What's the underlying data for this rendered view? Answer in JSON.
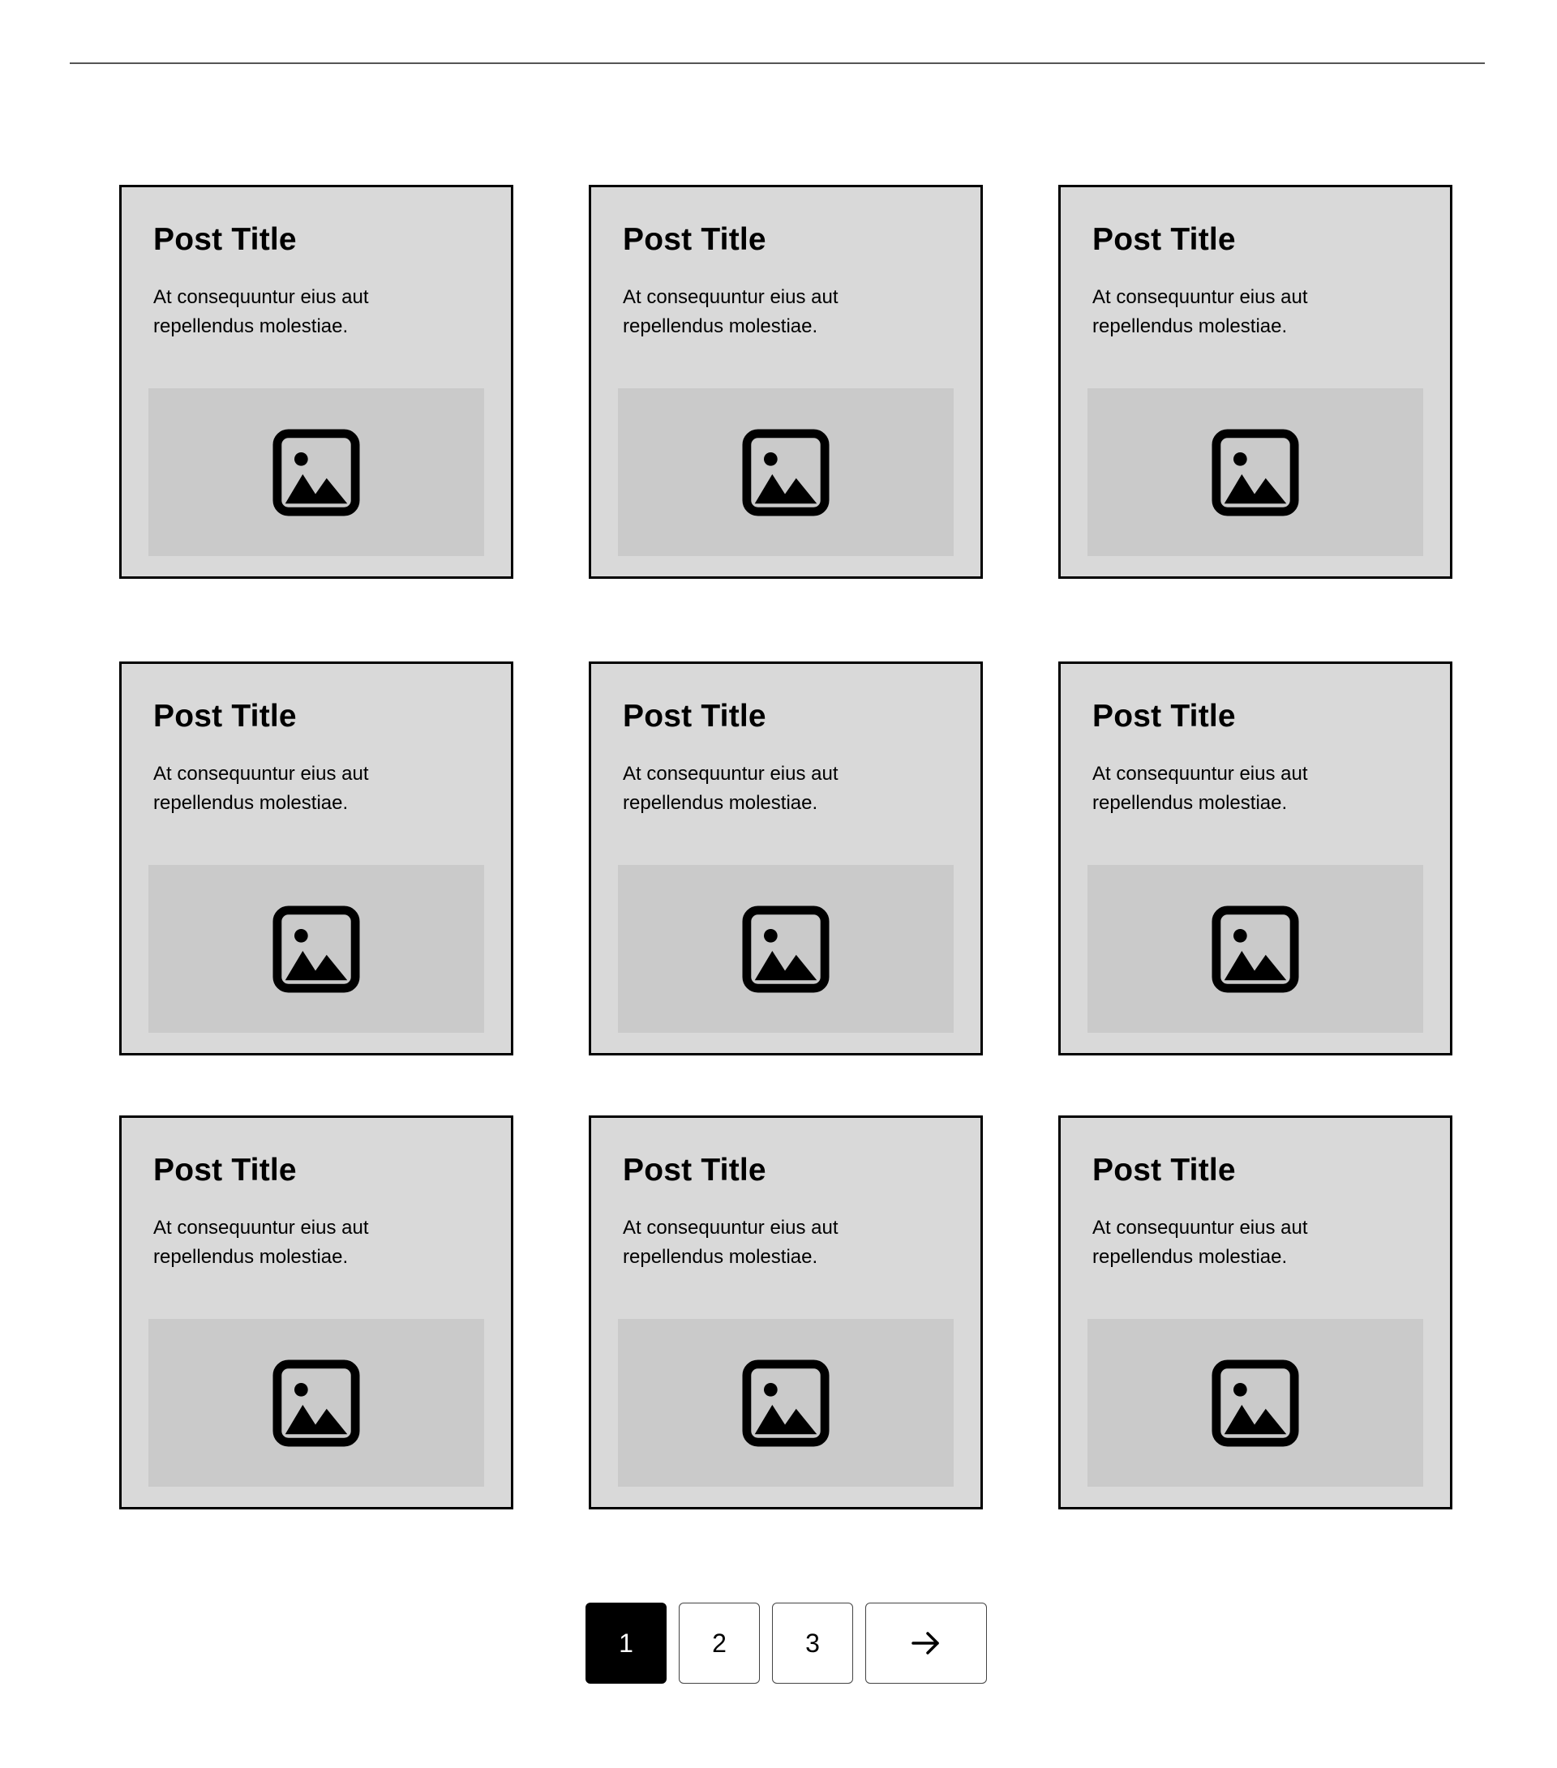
{
  "posts": [
    {
      "title": "Post Title",
      "excerpt": "At consequuntur eius aut repellendus molestiae.",
      "image_icon": "image-placeholder-icon"
    },
    {
      "title": "Post Title",
      "excerpt": "At consequuntur eius aut repellendus molestiae.",
      "image_icon": "image-placeholder-icon"
    },
    {
      "title": "Post Title",
      "excerpt": "At consequuntur eius aut repellendus molestiae.",
      "image_icon": "image-placeholder-icon"
    },
    {
      "title": "Post Title",
      "excerpt": "At consequuntur eius aut repellendus molestiae.",
      "image_icon": "image-placeholder-icon"
    },
    {
      "title": "Post Title",
      "excerpt": "At consequuntur eius aut repellendus molestiae.",
      "image_icon": "image-placeholder-icon"
    },
    {
      "title": "Post Title",
      "excerpt": "At consequuntur eius aut repellendus molestiae.",
      "image_icon": "image-placeholder-icon"
    },
    {
      "title": "Post Title",
      "excerpt": "At consequuntur eius aut repellendus molestiae.",
      "image_icon": "image-placeholder-icon"
    },
    {
      "title": "Post Title",
      "excerpt": "At consequuntur eius aut repellendus molestiae.",
      "image_icon": "image-placeholder-icon"
    },
    {
      "title": "Post Title",
      "excerpt": "At consequuntur eius aut repellendus molestiae.",
      "image_icon": "image-placeholder-icon"
    }
  ],
  "pagination": {
    "pages": [
      "1",
      "2",
      "3"
    ],
    "current_page": "1",
    "next_icon": "arrow-right-icon"
  },
  "colors": {
    "card_background": "#d9d9d9",
    "image_background": "#cacaca",
    "active_page": "#000000"
  }
}
